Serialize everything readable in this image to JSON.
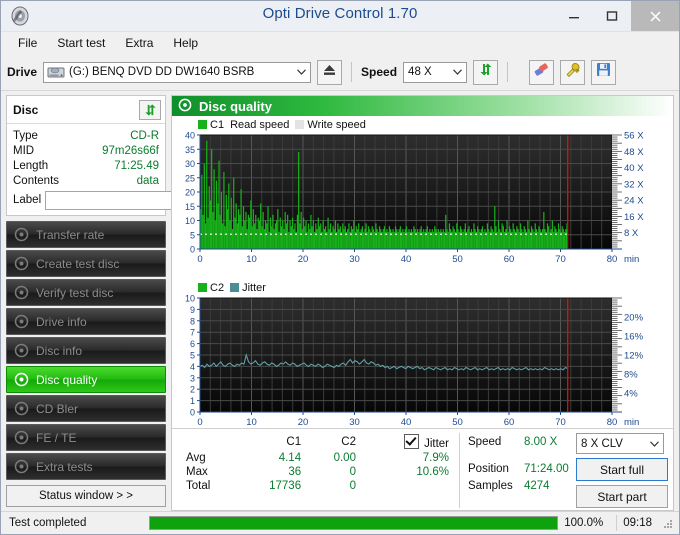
{
  "window": {
    "title": "Opti Drive Control 1.70",
    "app_icon": "disc-icon",
    "minimize": "–",
    "maximize": "□",
    "close": "✕"
  },
  "menu": {
    "items": [
      "File",
      "Start test",
      "Extra",
      "Help"
    ]
  },
  "toolbar": {
    "drive_label": "Drive",
    "drive_value": "(G:)   BENQ DVD DD DW1640 BSRB",
    "eject_icon": "eject-icon",
    "speed_label": "Speed",
    "speed_value": "48 X",
    "refresh_icon": "refresh-icon",
    "erase_icon": "eraser-icon",
    "tools_icon": "wrench-icon",
    "save_icon": "floppy-save-icon"
  },
  "disc": {
    "title": "Disc",
    "refresh_icon": "refresh-icon",
    "rows": [
      {
        "key": "Type",
        "value": "CD-R"
      },
      {
        "key": "MID",
        "value": "97m26s66f"
      },
      {
        "key": "Length",
        "value": "71:25.49"
      },
      {
        "key": "Contents",
        "value": "data"
      }
    ],
    "label_key": "Label",
    "label_value": "",
    "label_placeholder": "",
    "label_icon": "cd-disc-icon"
  },
  "sidebar": {
    "items": [
      {
        "label": "Transfer rate",
        "icon": "disc-icon",
        "active": false
      },
      {
        "label": "Create test disc",
        "icon": "disc-icon",
        "active": false
      },
      {
        "label": "Verify test disc",
        "icon": "disc-icon",
        "active": false
      },
      {
        "label": "Drive info",
        "icon": "disc-icon",
        "active": false
      },
      {
        "label": "Disc info",
        "icon": "disc-icon",
        "active": false
      },
      {
        "label": "Disc quality",
        "icon": "disc-icon",
        "active": true
      },
      {
        "label": "CD Bler",
        "icon": "disc-icon",
        "active": false
      },
      {
        "label": "FE / TE",
        "icon": "disc-icon",
        "active": false
      },
      {
        "label": "Extra tests",
        "icon": "disc-icon",
        "active": false
      }
    ],
    "status_window": "Status window > >"
  },
  "panel": {
    "title": "Disc quality",
    "title_icon": "disc-icon"
  },
  "chart_data": [
    {
      "type": "bar",
      "name": "c1-chart",
      "title": "",
      "legend": [
        {
          "label": "C1",
          "color": "#17b219"
        },
        {
          "label": "Read speed",
          "color": "#ffffff"
        },
        {
          "label": "Write speed",
          "color": "#e0e0e0"
        }
      ],
      "legend_position": "top-left",
      "xlabel": "min",
      "ylabel": "",
      "xlim": [
        0,
        80
      ],
      "xticks": [
        0,
        10,
        20,
        30,
        40,
        50,
        60,
        70,
        80
      ],
      "ylim": [
        0,
        40
      ],
      "yticks": [
        0,
        5,
        10,
        15,
        20,
        25,
        30,
        35,
        40
      ],
      "y2label": "X",
      "y2lim": [
        0,
        56
      ],
      "y2ticks": [
        "8 X",
        "16 X",
        "24 X",
        "32 X",
        "40 X",
        "48 X",
        "56 X"
      ],
      "grid": true,
      "marker_line_x": 71.4,
      "marker_line_color": "#e01010",
      "data_end_x": 71.4,
      "read_speed_value": 8.0,
      "read_speed_series_color": "#ffffff",
      "values": [
        14,
        26,
        12,
        30,
        9,
        38,
        11,
        22,
        17,
        35,
        13,
        28,
        10,
        24,
        16,
        31,
        12,
        20,
        9,
        27,
        8,
        19,
        14,
        23,
        10,
        18,
        7,
        25,
        11,
        16,
        9,
        14,
        12,
        21,
        8,
        15,
        10,
        13,
        7,
        12,
        11,
        17,
        8,
        14,
        9,
        12,
        7,
        11,
        10,
        16,
        8,
        13,
        7,
        10,
        9,
        15,
        6,
        11,
        8,
        12,
        7,
        9,
        10,
        14,
        6,
        11,
        8,
        10,
        7,
        13,
        9,
        12,
        6,
        10,
        8,
        11,
        7,
        9,
        6,
        12,
        34,
        9,
        13,
        7,
        11,
        8,
        10,
        6,
        9,
        7,
        12,
        8,
        10,
        6,
        9,
        7,
        11,
        8,
        9,
        6,
        10,
        7,
        8,
        6,
        11,
        7,
        9,
        6,
        8,
        7,
        10,
        6,
        9,
        7,
        8,
        6,
        9,
        7,
        8,
        6,
        7,
        9,
        6,
        8,
        7,
        10,
        6,
        8,
        7,
        9,
        6,
        7,
        8,
        6,
        7,
        9,
        6,
        8,
        7,
        6,
        8,
        7,
        6,
        9,
        7,
        6,
        8,
        7,
        6,
        7,
        8,
        6,
        7,
        6,
        8,
        7,
        6,
        7,
        6,
        8,
        7,
        6,
        7,
        8,
        6,
        7,
        6,
        7,
        8,
        6,
        7,
        6,
        7,
        6,
        8,
        7,
        6,
        7,
        6,
        7,
        8,
        6,
        7,
        6,
        7,
        8,
        6,
        7,
        6,
        7,
        6,
        8,
        7,
        6,
        7,
        6,
        7,
        6,
        7,
        6,
        12,
        7,
        6,
        9,
        7,
        6,
        8,
        7,
        6,
        9,
        7,
        6,
        8,
        7,
        6,
        7,
        9,
        6,
        7,
        8,
        6,
        7,
        6,
        9,
        7,
        6,
        8,
        7,
        6,
        7,
        8,
        6,
        7,
        6,
        9,
        7,
        6,
        8,
        7,
        6,
        15,
        8,
        6,
        10,
        7,
        6,
        9,
        8,
        6,
        7,
        10,
        6,
        8,
        7,
        6,
        9,
        7,
        6,
        8,
        7,
        6,
        9,
        7,
        6,
        8,
        7,
        6,
        10,
        7,
        6,
        8,
        7,
        6,
        9,
        7,
        6,
        8,
        7,
        6,
        7,
        13,
        7,
        6,
        9,
        8,
        6,
        7,
        10,
        6,
        8,
        7,
        6,
        9,
        7,
        6,
        8,
        7,
        6,
        7,
        9
      ]
    },
    {
      "type": "line",
      "name": "c2-jitter-chart",
      "title": "",
      "legend": [
        {
          "label": "C2",
          "color": "#17b219"
        },
        {
          "label": "Jitter",
          "color": "#4a8f93"
        }
      ],
      "legend_position": "top-left",
      "xlabel": "min",
      "xlim": [
        0,
        80
      ],
      "xticks": [
        0,
        10,
        20,
        30,
        40,
        50,
        60,
        70,
        80
      ],
      "ylim": [
        0,
        10
      ],
      "yticks": [
        0,
        1,
        2,
        3,
        4,
        5,
        6,
        7,
        8,
        9,
        10
      ],
      "y2label": "%",
      "y2lim": [
        0,
        20
      ],
      "y2ticks": [
        "4%",
        "8%",
        "12%",
        "16%",
        "20%"
      ],
      "grid": true,
      "marker_line_x": 71.4,
      "marker_line_color": "#e01010",
      "series": [
        {
          "name": "Jitter",
          "color": "#5fa0a5",
          "values": [
            4.0,
            4.1,
            3.9,
            4.2,
            4.0,
            4.1,
            4.3,
            4.0,
            4.2,
            4.4,
            4.1,
            4.0,
            4.2,
            4.3,
            4.1,
            4.0,
            4.2,
            4.1,
            4.3,
            4.2,
            5.0,
            4.4,
            4.2,
            4.3,
            4.5,
            4.2,
            4.1,
            4.3,
            4.4,
            4.2,
            4.1,
            4.3,
            4.2,
            4.0,
            4.1,
            4.3,
            4.2,
            4.4,
            4.2,
            4.1,
            4.3,
            4.2,
            4.0,
            4.1,
            4.2,
            4.3,
            4.1,
            4.0,
            4.2,
            4.1,
            4.0,
            4.2,
            4.1,
            3.9,
            4.0,
            4.2,
            4.1,
            4.0,
            3.9,
            4.1,
            4.0,
            4.2,
            4.3,
            4.1,
            4.4,
            4.6,
            4.3,
            4.5,
            4.4,
            4.2,
            4.4,
            4.6,
            4.3,
            4.2,
            4.4,
            4.3,
            4.1,
            4.2,
            4.0,
            4.1,
            3.9,
            4.0,
            3.8,
            3.9,
            4.0,
            3.8,
            3.9,
            4.0,
            3.9,
            3.8,
            4.0,
            3.9,
            3.8,
            3.9,
            4.0,
            3.8,
            3.9,
            3.7,
            3.8,
            3.9,
            3.8,
            3.7,
            3.9,
            3.8,
            3.7,
            3.8,
            3.9,
            3.7,
            3.8,
            3.7,
            3.9,
            3.8,
            3.7,
            3.8,
            3.7,
            3.9,
            3.8,
            3.7,
            3.8,
            3.9,
            3.7,
            3.8,
            3.7,
            3.8,
            3.9,
            3.7,
            3.8,
            3.7,
            3.8,
            3.9,
            3.7,
            3.8,
            3.7,
            3.8,
            3.7,
            3.9,
            3.8,
            3.7,
            3.8,
            3.7,
            3.8,
            3.9,
            3.7,
            3.8,
            3.7,
            3.8,
            3.7,
            3.8,
            3.7,
            3.9,
            3.8,
            3.7,
            3.8,
            3.7,
            3.8,
            3.7,
            3.8,
            3.7,
            3.9,
            3.8
          ]
        },
        {
          "name": "C2",
          "color": "#17b219",
          "values": []
        }
      ]
    }
  ],
  "stats": {
    "headers": [
      "",
      "C1",
      "C2",
      "Jitter"
    ],
    "jitter_checked": true,
    "rows": [
      {
        "label": "Avg",
        "c1": "4.14",
        "c2": "0.00",
        "jitter": "7.9%"
      },
      {
        "label": "Max",
        "c1": "36",
        "c2": "0",
        "jitter": "10.6%"
      },
      {
        "label": "Total",
        "c1": "17736",
        "c2": "0",
        "jitter": ""
      }
    ]
  },
  "readout": {
    "speed_label": "Speed",
    "speed_value": "8.00 X",
    "position_label": "Position",
    "position_value": "71:24.00",
    "samples_label": "Samples",
    "samples_value": "4274",
    "clv_value": "8 X CLV",
    "start_full": "Start full",
    "start_part": "Start part"
  },
  "statusbar": {
    "text": "Test completed",
    "progress_pct": "100.0%",
    "progress_value": 100,
    "time": "09:18"
  },
  "colors": {
    "accent_green": "#17b219",
    "value_green": "#0a7c2f",
    "marker_red": "#e01010",
    "jitter_teal": "#5fa0a5",
    "axis_blue": "#1d4b8f"
  }
}
